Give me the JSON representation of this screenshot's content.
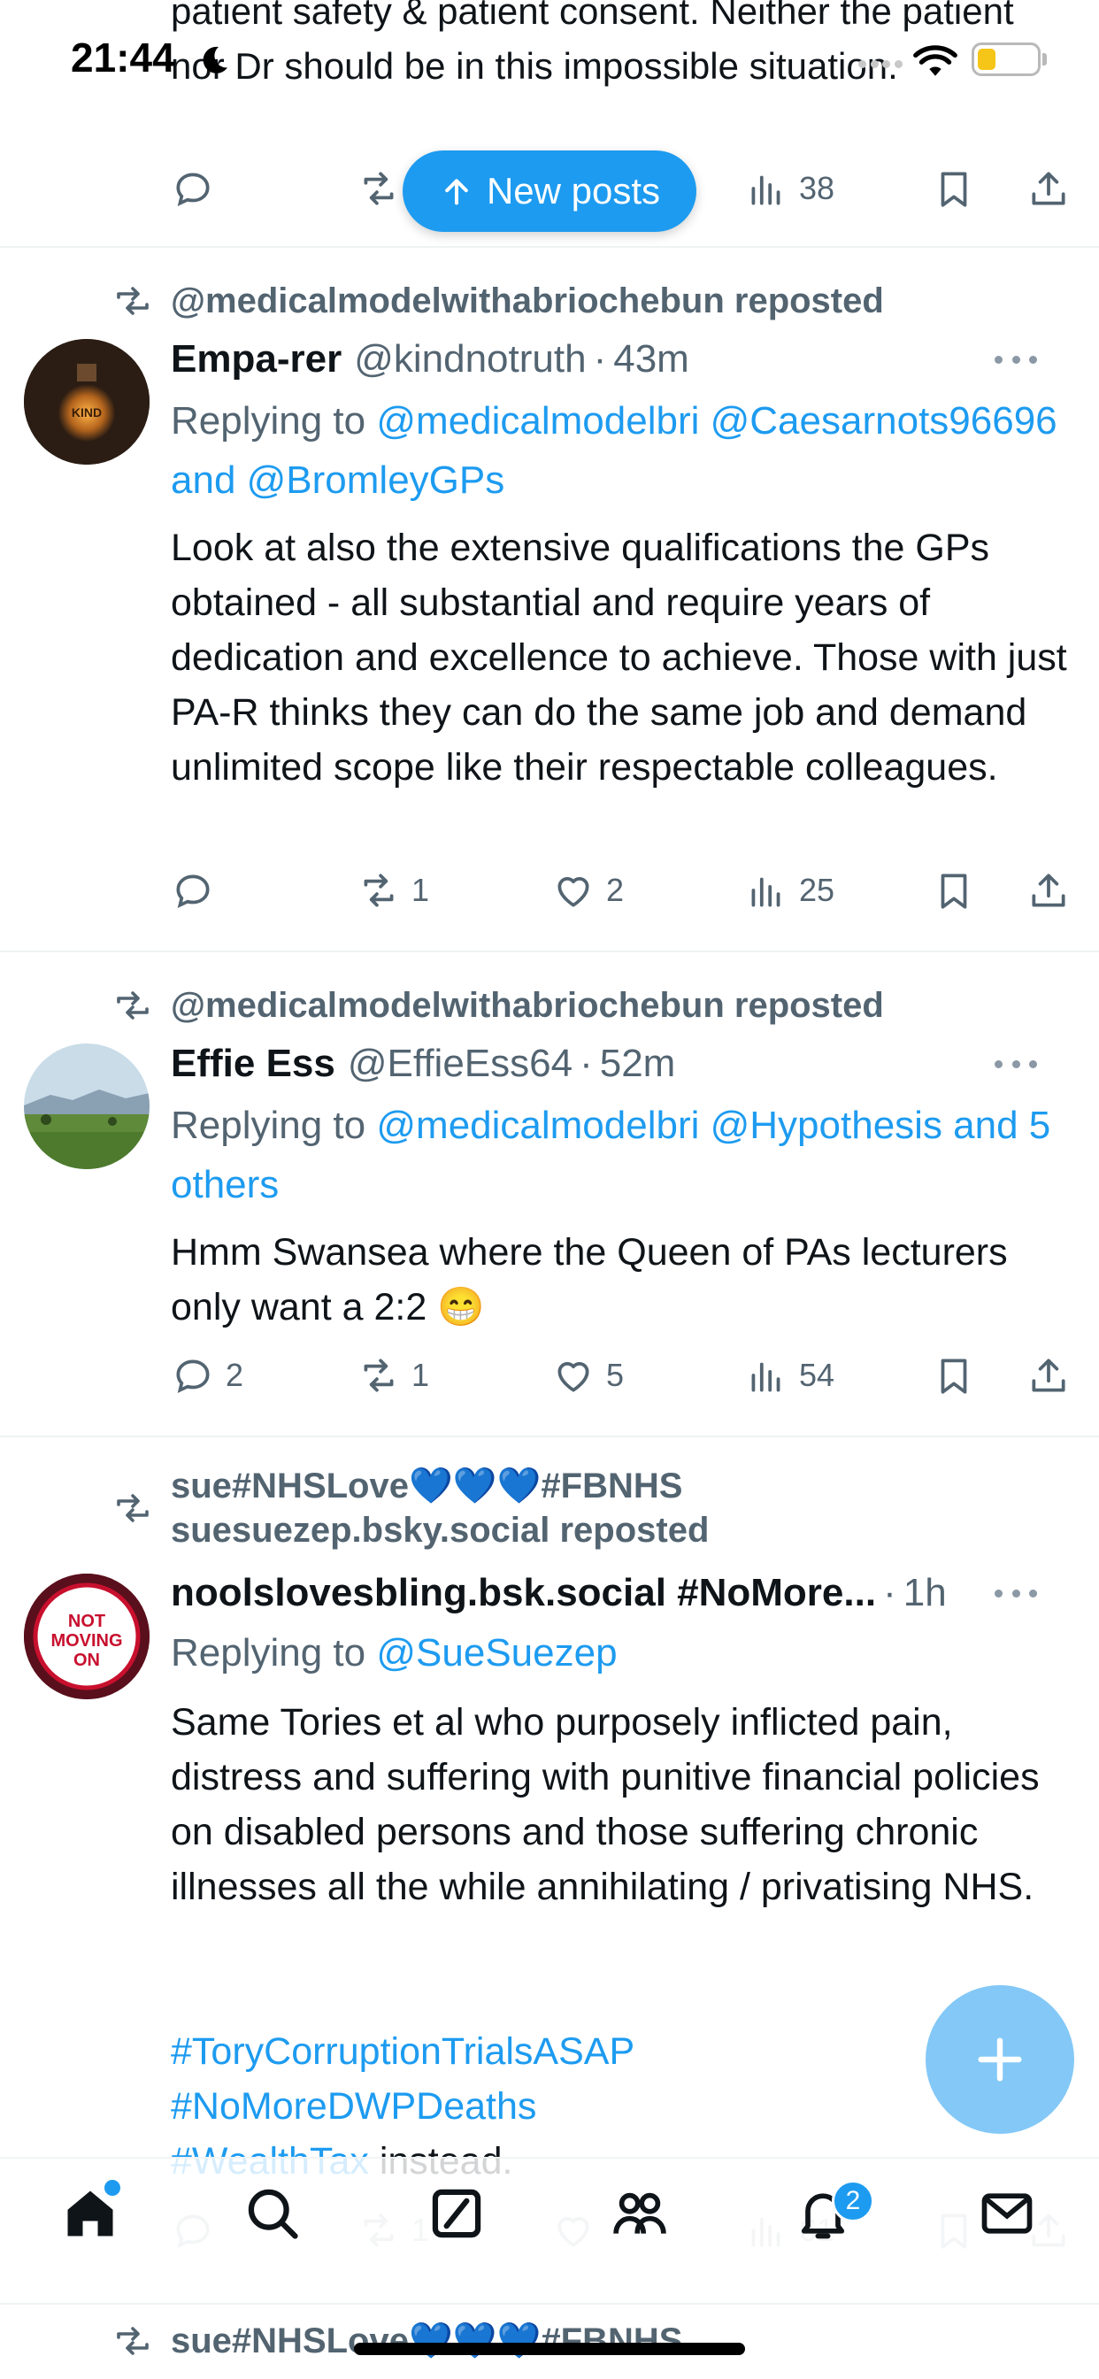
{
  "status_bar": {
    "time": "21:44"
  },
  "new_posts": {
    "label": "New posts"
  },
  "post0": {
    "text": "patient safety & patient consent. Neither the patient nor Dr should be in this impossible situation.",
    "views": "38"
  },
  "posts": [
    {
      "reposted_by": "@medicalmodelwithabriochebun reposted",
      "name": "Empa-rer",
      "handle": "@kindnotruth",
      "time": "43m",
      "replying_prefix": "Replying to",
      "replying_to": "@medicalmodelbri @Caesarnots96696 and @BromleyGPs",
      "text": "Look at also the extensive qualifications the GPs obtained - all substantial and require years of dedication and excellence to achieve. Those with just PA-R thinks they can do the same job and demand unlimited scope like their respectable colleagues.",
      "replies": "",
      "reposts": "1",
      "likes": "2",
      "views": "25",
      "avatar_text": "KIND"
    },
    {
      "reposted_by": "@medicalmodelwithabriochebun reposted",
      "name": "Effie Ess",
      "handle": "@EffieEss64",
      "time": "52m",
      "replying_prefix": "Replying to",
      "replying_to": "@medicalmodelbri @Hypothesis and 5 others",
      "text": "Hmm Swansea where the Queen of PAs lecturers only want a 2:2 😁",
      "replies": "2",
      "reposts": "1",
      "likes": "5",
      "views": "54"
    },
    {
      "reposted_by_line1": "sue#NHSLove💙💙💙#FBNHS",
      "reposted_by_line2": "suesuezep.bsky.social reposted",
      "name": "noolslovesbling.bsk.social #NoMore...",
      "time": "1h",
      "replying_prefix": "Replying to",
      "replying_to": "@SueSuezep",
      "text": "Same Tories et al who purposely inflicted pain, distress and suffering with punitive financial policies on disabled persons and those suffering chronic illnesses all the while annihilating / privatising NHS.",
      "hashtags": [
        "#ToryCorruptionTrialsASAP",
        "#NoMoreDWPDeaths",
        "#WealthTax"
      ],
      "trailing": " instead.",
      "avatar_text": "NOT MOVING ON",
      "ghost_reposts": "1",
      "ghost_views": "61"
    }
  ],
  "peek_post": {
    "reposted_by": "sue#NHSLove💙💙💙#FBNHS"
  },
  "nav": {
    "notification_count": "2"
  },
  "colors": {
    "accent": "#1d9bf0",
    "muted": "#536471",
    "text": "#0f1419"
  },
  "icons": {
    "actions": [
      "reply-icon",
      "repost-icon",
      "like-icon",
      "views-icon",
      "bookmark-icon",
      "share-icon"
    ],
    "nav": [
      "home-icon",
      "search-icon",
      "grok-icon",
      "communities-icon",
      "notifications-icon",
      "messages-icon"
    ]
  }
}
